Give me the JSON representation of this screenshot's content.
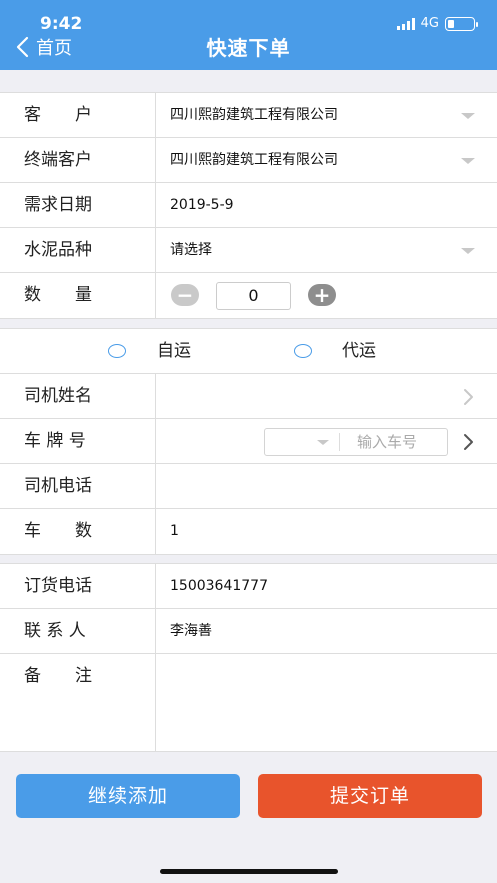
{
  "status": {
    "time": "9:42",
    "network": "4G"
  },
  "header": {
    "back_label": "首页",
    "title": "快速下单"
  },
  "order": {
    "customer": {
      "label": "客　　户",
      "value": "四川熙韵建筑工程有限公司"
    },
    "end_customer": {
      "label": "终端客户",
      "value": "四川熙韵建筑工程有限公司"
    },
    "date": {
      "label": "需求日期",
      "value": "2019-5-9"
    },
    "cement": {
      "label": "水泥品种",
      "value": "请选择"
    },
    "quantity": {
      "label": "数　　量",
      "value": "0",
      "minus": "−",
      "plus": "+"
    }
  },
  "transport": {
    "self": "自运",
    "agent": "代运",
    "driver_name": {
      "label": "司机姓名",
      "value": ""
    },
    "plate": {
      "label": "车 牌 号",
      "placeholder": "输入车号"
    },
    "driver_phone": {
      "label": "司机电话",
      "value": ""
    },
    "vehicles": {
      "label": "车　　数",
      "value": "1"
    }
  },
  "contact": {
    "order_phone": {
      "label": "订货电话",
      "value": "15003641777"
    },
    "contact_person": {
      "label": "联 系 人",
      "value": "李海善"
    },
    "remark": {
      "label": "备　　注",
      "value": ""
    }
  },
  "actions": {
    "continue_add": "继续添加",
    "submit": "提交订单"
  },
  "colors": {
    "primary": "#4a9ce8",
    "submit": "#e8542c",
    "background": "#efeff4"
  },
  "icons": {
    "back": "chevron-left-icon",
    "dropdown": "caret-down-icon",
    "arrow": "chevron-right-icon"
  }
}
